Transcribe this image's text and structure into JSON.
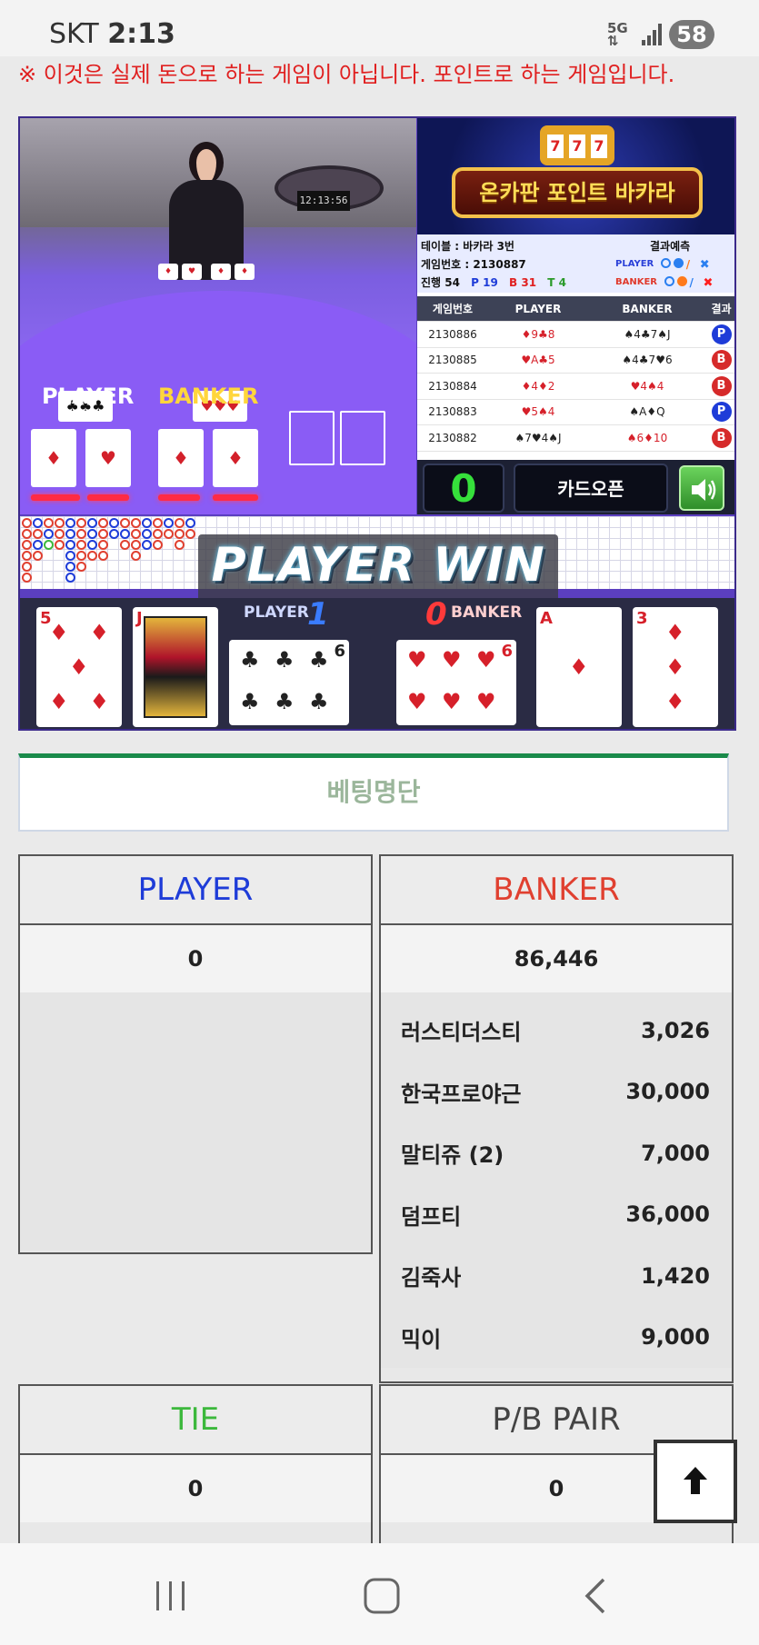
{
  "status": {
    "carrier": "SKT",
    "time": "2:13",
    "network": "5G",
    "battery": "58"
  },
  "notice": "※ 이것은 실제 돈으로 하는 게임이 아닙니다. 포인트로 하는 게임입니다.",
  "game": {
    "video": {
      "clock": "12:13:56",
      "player_label": "PLAYER",
      "banker_label": "BANKER"
    },
    "logo_text": "온카판 포인트 바카라",
    "info": {
      "table": "테이블 : 바카라 3번",
      "game_no": "게임번호 : 2130887",
      "progress_label": "진행 54",
      "p_count": "P 19",
      "b_count": "B 31",
      "t_count": "T 4",
      "prediction_label": "결과예측",
      "player_row_label": "PLAYER",
      "banker_row_label": "BANKER"
    },
    "history": {
      "headers": [
        "게임번호",
        "PLAYER",
        "BANKER",
        "결과"
      ],
      "rows": [
        {
          "no": "2130886",
          "player": "♦9♣8",
          "banker": "♠4♣7♠J",
          "result": "P"
        },
        {
          "no": "2130885",
          "player": "♥A♣5",
          "banker": "♠4♣7♥6",
          "result": "B"
        },
        {
          "no": "2130884",
          "player": "♦4♦2",
          "banker": "♥4♠4",
          "result": "B"
        },
        {
          "no": "2130883",
          "player": "♥5♠4",
          "banker": "♠A♦Q",
          "result": "P"
        },
        {
          "no": "2130882",
          "player": "♠7♥4♠J",
          "banker": "♠6♦10",
          "result": "B"
        }
      ]
    },
    "counter": "0",
    "card_open_label": "카드오픈",
    "win_banner": "PLAYER WIN",
    "result": {
      "player_label": "PLAYER",
      "player_score": "1",
      "banker_label": "BANKER",
      "banker_score": "0",
      "cards": [
        {
          "rank": "5",
          "suit": "♦"
        },
        {
          "rank": "J",
          "suit": "♥"
        },
        {
          "rank": "6",
          "suit": "♣"
        },
        {
          "rank": "6",
          "suit": "♥"
        },
        {
          "rank": "A",
          "suit": "♦"
        },
        {
          "rank": "3",
          "suit": "♦"
        }
      ]
    },
    "colors": {
      "player": "#1e3cd8",
      "banker": "#e04030",
      "tie": "#3cb83c"
    }
  },
  "betting": {
    "title": "베팅명단",
    "player": {
      "label": "PLAYER",
      "total": "0",
      "entries": []
    },
    "banker": {
      "label": "BANKER",
      "total": "86,446",
      "entries": [
        {
          "name": "러스티더스티",
          "amount": "3,026"
        },
        {
          "name": "한국프로야근",
          "amount": "30,000"
        },
        {
          "name": "말티쥬 (2)",
          "amount": "7,000"
        },
        {
          "name": "덤프티",
          "amount": "36,000"
        },
        {
          "name": "김죽사",
          "amount": "1,420"
        },
        {
          "name": "믹이",
          "amount": "9,000"
        }
      ]
    },
    "tie": {
      "label": "TIE",
      "total": "0"
    },
    "pair": {
      "label": "P/B PAIR",
      "total": "0"
    }
  }
}
